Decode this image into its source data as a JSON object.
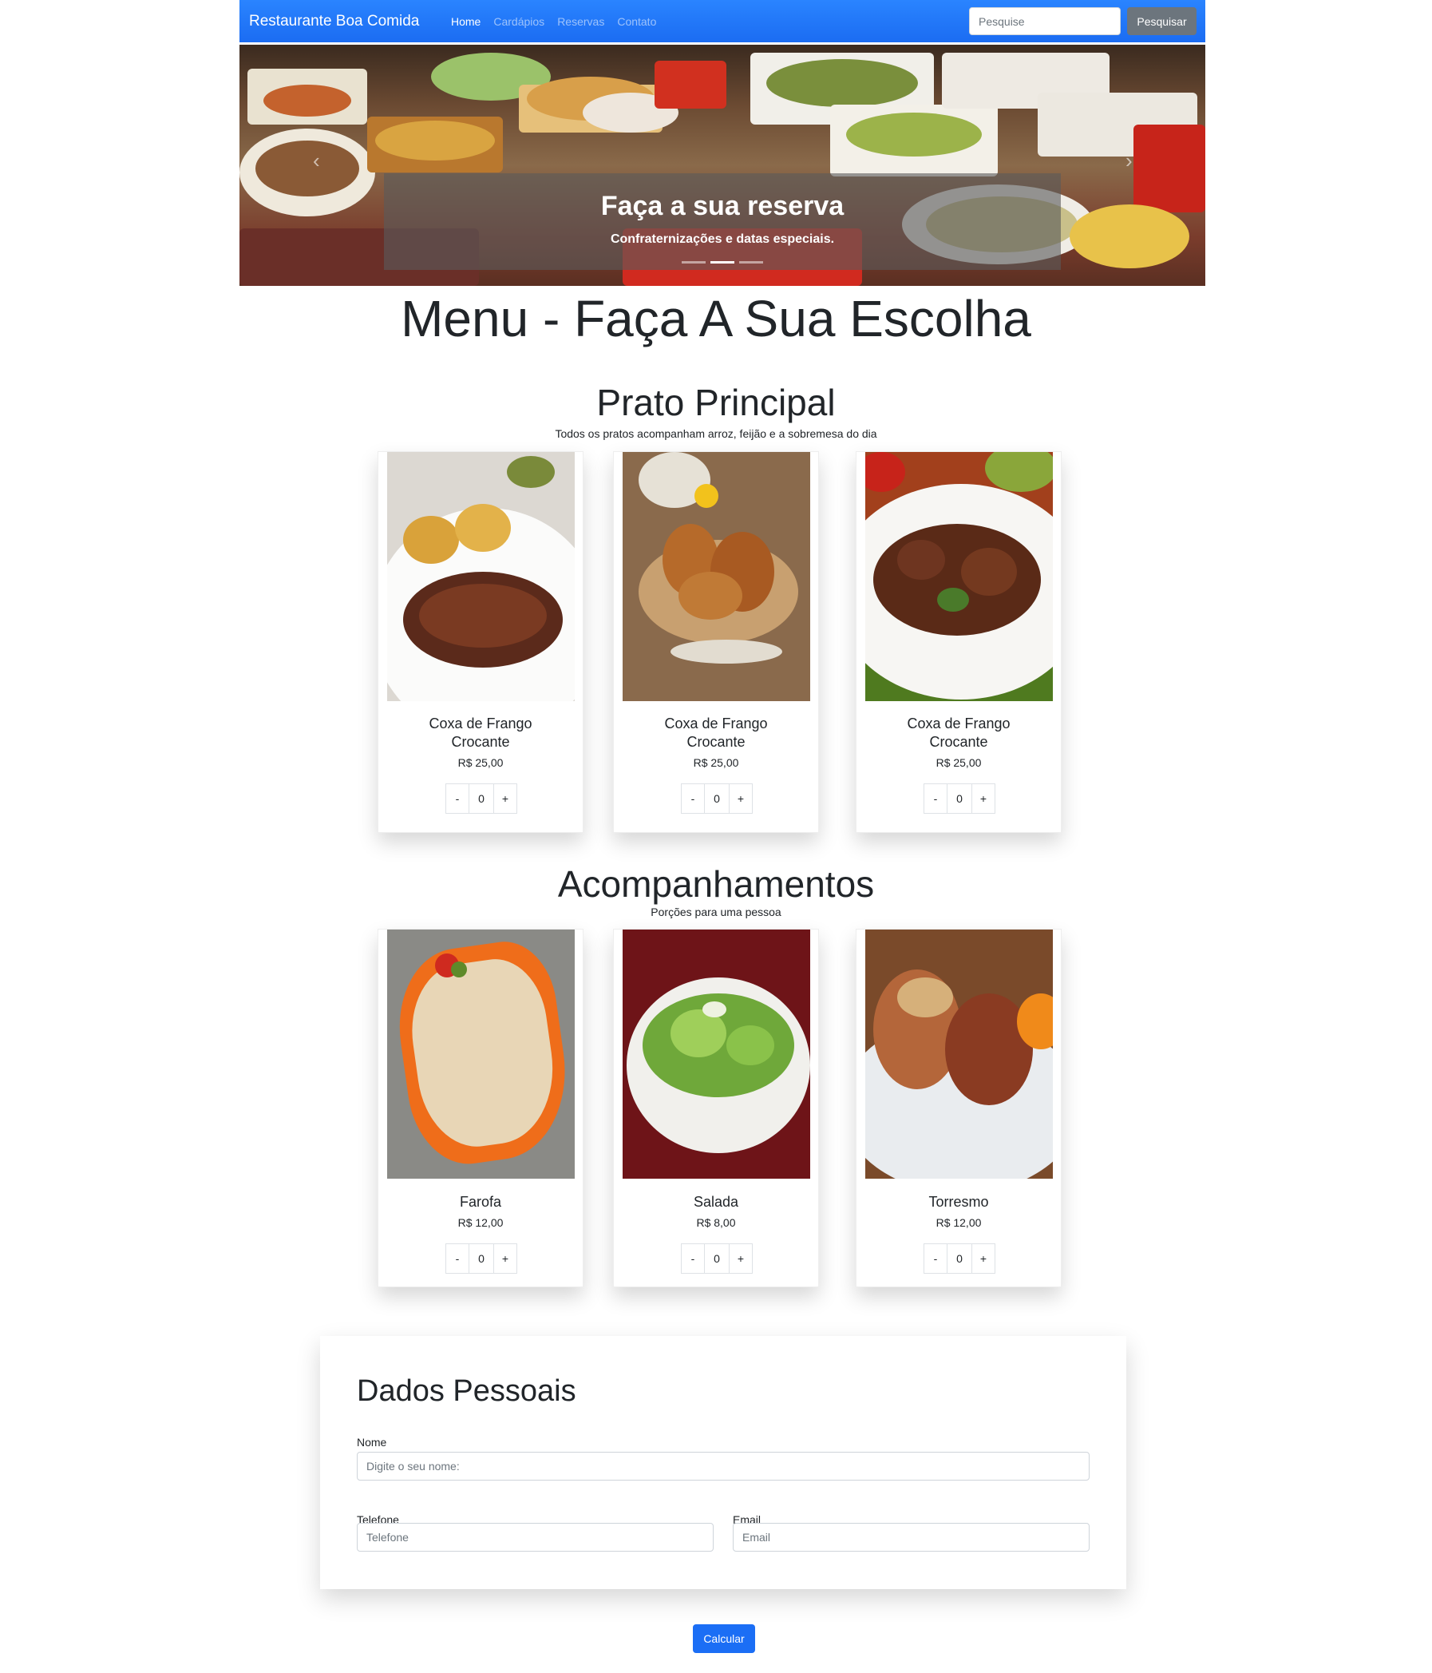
{
  "navbar": {
    "brand": "Restaurante Boa Comida",
    "links": [
      "Home",
      "Cardápios",
      "Reservas",
      "Contato"
    ],
    "search_placeholder": "Pesquise",
    "search_button": "Pesquisar",
    "color": "#1b6cf2"
  },
  "carousel": {
    "title": "Faça a sua reserva",
    "subtitle": "Confraternizações e datas especiais.",
    "prev_icon": "‹",
    "next_icon": "›",
    "active_slide": 2,
    "slide_count": 3
  },
  "menu": {
    "title": "Menu - Faça A Sua Escolha"
  },
  "sections": [
    {
      "title": "Prato Principal",
      "subtitle": "Todos os pratos acompanham arroz, feijão e a sobremesa do dia",
      "items": [
        {
          "name": "Coxa de Frango Crocante",
          "price": "R$ 25,00",
          "qty": "0",
          "image": "grilled-steak-image"
        },
        {
          "name": "Coxa de Frango Crocante",
          "price": "R$ 25,00",
          "qty": "0",
          "image": "fried-chicken-image"
        },
        {
          "name": "Coxa de Frango Crocante",
          "price": "R$ 25,00",
          "qty": "0",
          "image": "beef-stew-image"
        }
      ]
    },
    {
      "title": "Acompanhamentos",
      "subtitle": "Porções para uma pessoa",
      "items": [
        {
          "name": "Farofa",
          "price": "R$ 12,00",
          "qty": "0",
          "image": "farofa-image"
        },
        {
          "name": "Salada",
          "price": "R$ 8,00",
          "qty": "0",
          "image": "salad-image"
        },
        {
          "name": "Torresmo",
          "price": "R$ 12,00",
          "qty": "0",
          "image": "torresmo-image"
        }
      ]
    }
  ],
  "qty_controls": {
    "minus": "-",
    "plus": "+"
  },
  "form": {
    "title": "Dados Pessoais",
    "name_label": "Nome",
    "name_placeholder": "Digite o seu nome:",
    "phone_label": "Telefone",
    "phone_placeholder": "Telefone",
    "email_label": "Email",
    "email_placeholder": "Email"
  },
  "calculate_button": "Calcular"
}
